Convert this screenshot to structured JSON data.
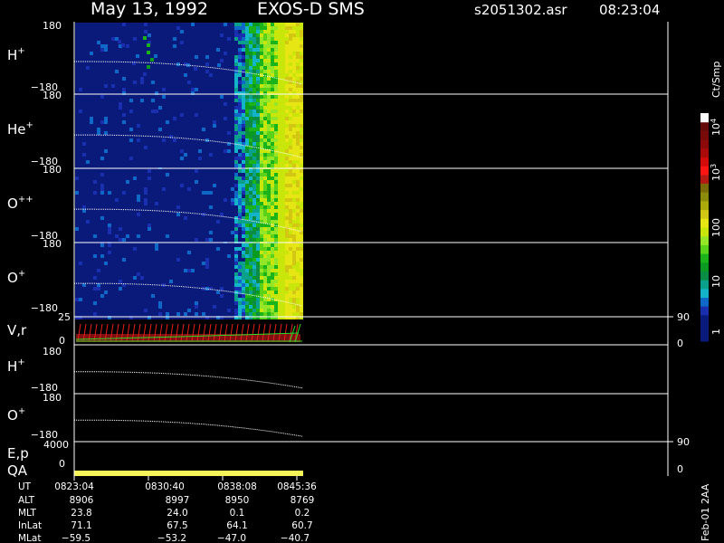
{
  "header": {
    "date": "May 13, 1992",
    "mission": "EXOS-D SMS",
    "file": "s2051302.asr",
    "time": "08:23:04"
  },
  "panels": {
    "h_plus": {
      "species": "H",
      "charge": "+",
      "top": "180",
      "bottom": "−180"
    },
    "he_plus": {
      "species": "He",
      "charge": "+",
      "top": "180",
      "bottom": "−180"
    },
    "o_plusplus": {
      "species": "O",
      "charge": "++",
      "top": "180",
      "bottom": "−180"
    },
    "o_plus": {
      "species": "O",
      "charge": "+",
      "top": "180",
      "bottom": "−180"
    },
    "vr": {
      "label": "V,r",
      "top": "25",
      "zero": "0",
      "right_top": "90",
      "right_zero": "0"
    },
    "h_plus_2": {
      "species": "H",
      "charge": "+",
      "top": "180",
      "bottom": "−180"
    },
    "o_plus_2": {
      "species": "O",
      "charge": "+",
      "top": "180",
      "bottom": "−180"
    },
    "ep": {
      "label": "E,p",
      "top": "4000",
      "zero": "0",
      "right_top": "90",
      "right_zero": "0"
    },
    "qa": {
      "label": "QA"
    }
  },
  "colorbar": {
    "unit": "Ct/Smp",
    "ticks": {
      "t1": "1",
      "t10": "10",
      "t100": "100",
      "t1000": "3",
      "t10000": "4"
    },
    "base": "10",
    "colors": [
      "#0a1a7a",
      "#0a1a7a",
      "#0a1a7a",
      "#1a2fb0",
      "#0e68c8",
      "#14b4c8",
      "#0aa08c",
      "#0a8c46",
      "#0a9a22",
      "#1ab41a",
      "#5ad21a",
      "#96e628",
      "#c8e60a",
      "#e6e614",
      "#d2c814",
      "#aaaa0a",
      "#8c8c0a",
      "#7a6a0a",
      "#b41a14",
      "#ff1414",
      "#d20a0a",
      "#aa0a0a",
      "#8c0a0a",
      "#780a0a",
      "#640a0a",
      "#ffffff"
    ]
  },
  "table": {
    "rows": [
      {
        "label": "UT",
        "values": [
          "0823:04",
          "0830:40",
          "0838:08",
          "0845:36"
        ]
      },
      {
        "label": "ALT",
        "values": [
          "8906",
          "8997",
          "8950",
          "8769"
        ]
      },
      {
        "label": "MLT",
        "values": [
          "23.8",
          "24.0",
          "0.1",
          "0.2"
        ]
      },
      {
        "label": "InLat",
        "values": [
          "71.1",
          "67.5",
          "64.1",
          "60.7"
        ]
      },
      {
        "label": "MLat",
        "values": [
          "−59.5",
          "−53.2",
          "−47.0",
          "−40.7"
        ]
      }
    ]
  },
  "footer": {
    "stamp": "Feb-01 2AA"
  },
  "chart_data": {
    "type": "heatmap",
    "title": "May 13, 1992   EXOS-D SMS",
    "species_panels": [
      "H+",
      "He+",
      "O+",
      "O+",
      "V,r",
      "H+",
      "O+",
      "E,p",
      "QA"
    ],
    "x_ticks": [
      "0823:04",
      "0830:40",
      "0838:08",
      "0845:36"
    ],
    "pitch_angle_range": [
      -180,
      180
    ],
    "velocity_range": [
      0,
      25
    ],
    "energy_range": [
      0,
      4000
    ],
    "colorbar_range": [
      1,
      10000
    ],
    "colorbar_scale": "log",
    "data_end_time": "0845:36",
    "colors": {
      "background": "#000000",
      "curve": "#ffffff",
      "qa": "#f5f55a",
      "vec_red": "#e61e1e",
      "vec_green": "#28dc28"
    }
  }
}
